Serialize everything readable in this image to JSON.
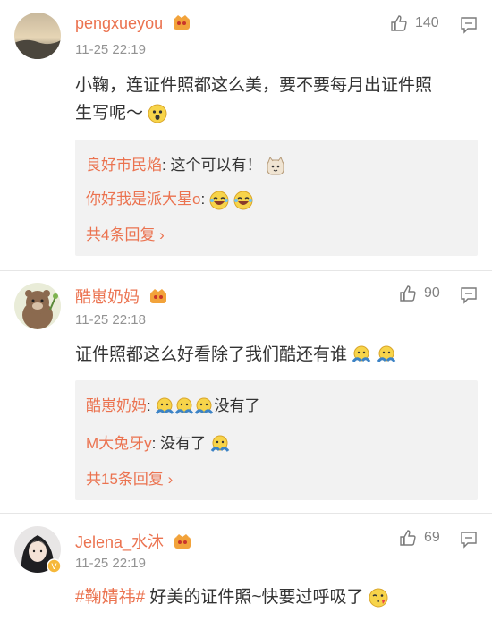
{
  "comments": [
    {
      "username": "pengxueyou",
      "time": "11-25 22:19",
      "likes": "140",
      "text_line1": "小鞠，连证件照都这么美，要不要每月出证件照",
      "text_line2": "生写呢～",
      "replies": [
        {
          "user": "良好市民焰",
          "text": ": 这个可以有！",
          "emoji": "cat-emoji"
        },
        {
          "user": "你好我是派大星o",
          "text": ":",
          "emoji": "laughing-emoji"
        }
      ],
      "more": "共4条回复 ›"
    },
    {
      "username": "酷崽奶妈",
      "time": "11-25 22:18",
      "likes": "90",
      "text": "证件照都这么好看除了我们酷还有谁",
      "replies": [
        {
          "user": "酷崽奶妈",
          "text": ":",
          "suffix": "没有了"
        },
        {
          "user": "M大兔牙y",
          "text": ": 没有了"
        }
      ],
      "more": "共15条回复 ›"
    },
    {
      "username": "Jelena_水沐",
      "time": "11-25 22:19",
      "likes": "69",
      "hashtag": "#鞠婧祎#",
      "text": " 好美的证件照~快要过呼吸了"
    }
  ],
  "colors": {
    "accent": "#eb7350",
    "gray": "#939393",
    "reply_bg": "#f2f2f2"
  }
}
